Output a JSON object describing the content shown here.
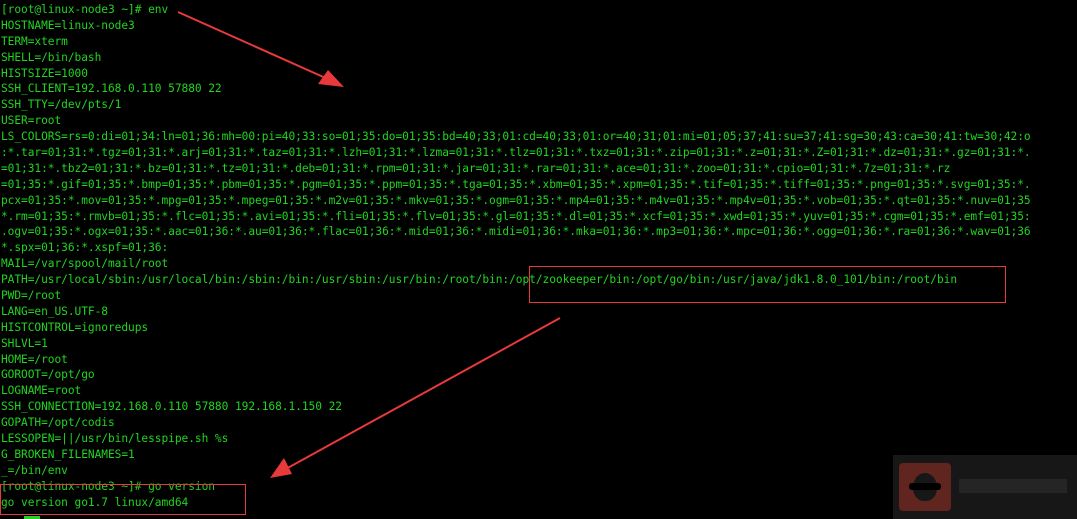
{
  "terminal": {
    "colors": {
      "background": "#000000",
      "text": "#21d421",
      "annotation": "#e83a3a"
    },
    "lines": [
      "[root@linux-node3 ~]# env",
      "HOSTNAME=linux-node3",
      "TERM=xterm",
      "SHELL=/bin/bash",
      "HISTSIZE=1000",
      "SSH_CLIENT=192.168.0.110 57880 22",
      "SSH_TTY=/dev/pts/1",
      "USER=root",
      "LS_COLORS=rs=0:di=01;34:ln=01;36:mh=00:pi=40;33:so=01;35:do=01;35:bd=40;33;01:cd=40;33;01:or=40;31;01:mi=01;05;37;41:su=37;41:sg=30;43:ca=30;41:tw=30;42:o",
      ":*.tar=01;31:*.tgz=01;31:*.arj=01;31:*.taz=01;31:*.lzh=01;31:*.lzma=01;31:*.tlz=01;31:*.txz=01;31:*.zip=01;31:*.z=01;31:*.Z=01;31:*.dz=01;31:*.gz=01;31:*.",
      "=01;31:*.tbz2=01;31:*.bz=01;31:*.tz=01;31:*.deb=01;31:*.rpm=01;31:*.jar=01;31:*.rar=01;31:*.ace=01;31:*.zoo=01;31:*.cpio=01;31:*.7z=01;31:*.rz",
      "=01;35:*.gif=01;35:*.bmp=01;35:*.pbm=01;35:*.pgm=01;35:*.ppm=01;35:*.tga=01;35:*.xbm=01;35:*.xpm=01;35:*.tif=01;35:*.tiff=01;35:*.png=01;35:*.svg=01;35:*.",
      "pcx=01;35:*.mov=01;35:*.mpg=01;35:*.mpeg=01;35:*.m2v=01;35:*.mkv=01;35:*.ogm=01;35:*.mp4=01;35:*.m4v=01;35:*.mp4v=01;35:*.vob=01;35:*.qt=01;35:*.nuv=01;35",
      "*.rm=01;35:*.rmvb=01;35:*.flc=01;35:*.avi=01;35:*.fli=01;35:*.flv=01;35:*.gl=01;35:*.dl=01;35:*.xcf=01;35:*.xwd=01;35:*.yuv=01;35:*.cgm=01;35:*.emf=01;35:",
      ".ogv=01;35:*.ogx=01;35:*.aac=01;36:*.au=01;36:*.flac=01;36:*.mid=01;36:*.midi=01;36:*.mka=01;36:*.mp3=01;36:*.mpc=01;36:*.ogg=01;36:*.ra=01;36:*.wav=01;36",
      "*.spx=01;36:*.xspf=01;36:",
      "MAIL=/var/spool/mail/root",
      "PATH=/usr/local/sbin:/usr/local/bin:/sbin:/bin:/usr/sbin:/usr/bin:/root/bin:/opt/zookeeper/bin:/opt/go/bin:/usr/java/jdk1.8.0_101/bin:/root/bin",
      "PWD=/root",
      "LANG=en_US.UTF-8",
      "HISTCONTROL=ignoredups",
      "SHLVL=1",
      "HOME=/root",
      "GOROOT=/opt/go",
      "LOGNAME=root",
      "SSH_CONNECTION=192.168.0.110 57880 192.168.1.150 22",
      "GOPATH=/opt/codis",
      "LESSOPEN=||/usr/bin/lesspipe.sh %s",
      "G_BROKEN_FILENAMES=1",
      "_=/bin/env",
      "[root@linux-node3 ~]# go version",
      "go version go1.7 linux/amd64"
    ]
  }
}
